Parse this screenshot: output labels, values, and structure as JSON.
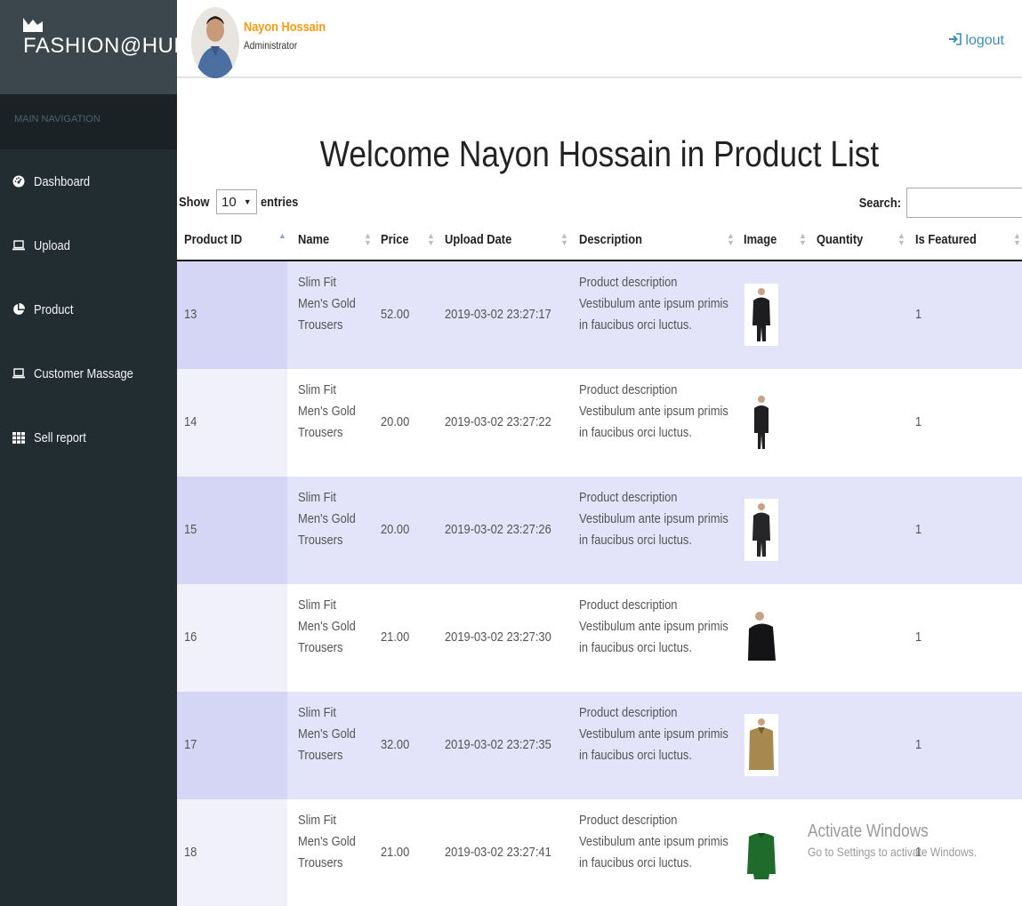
{
  "brand": {
    "name": "FASHION@HUB"
  },
  "sidebar": {
    "header": "MAIN NAVIGATION",
    "items": [
      {
        "label": "Dashboard",
        "icon": "dashboard-icon"
      },
      {
        "label": "Upload",
        "icon": "laptop-icon"
      },
      {
        "label": "Product",
        "icon": "pie-chart-icon"
      },
      {
        "label": "Customer Massage",
        "icon": "laptop-icon"
      },
      {
        "label": "Sell report",
        "icon": "grid-icon"
      }
    ]
  },
  "header": {
    "user_name": "Nayon Hossain",
    "user_role": "Administrator",
    "logout_label": "logout"
  },
  "main": {
    "title": "Welcome Nayon Hossain in Product List",
    "show_label": "Show",
    "entries_value": "10",
    "entries_label": "entries",
    "search_label": "Search:",
    "search_value": ""
  },
  "table": {
    "columns": [
      "Product ID",
      "Name",
      "Price",
      "Upload Date",
      "Description",
      "Image",
      "Quantity",
      "Is Featured"
    ],
    "rows": [
      {
        "id": "13",
        "name": [
          "Slim Fit",
          "Men's Gold",
          "Trousers"
        ],
        "price": "52.00",
        "date": "2019-03-02 23:27:17",
        "desc": [
          "Product description",
          "Vestibulum ante ipsum primis",
          "in faucibus orci luctus."
        ],
        "quantity": "",
        "featured": "1",
        "image_color": "#1d1d1f"
      },
      {
        "id": "14",
        "name": [
          "Slim Fit",
          "Men's Gold",
          "Trousers"
        ],
        "price": "20.00",
        "date": "2019-03-02 23:27:22",
        "desc": [
          "Product description",
          "Vestibulum ante ipsum primis",
          "in faucibus orci luctus."
        ],
        "quantity": "",
        "featured": "1",
        "image_color": "#202022"
      },
      {
        "id": "15",
        "name": [
          "Slim Fit",
          "Men's Gold",
          "Trousers"
        ],
        "price": "20.00",
        "date": "2019-03-02 23:27:26",
        "desc": [
          "Product description",
          "Vestibulum ante ipsum primis",
          "in faucibus orci luctus."
        ],
        "quantity": "",
        "featured": "1",
        "image_color": "#262628"
      },
      {
        "id": "16",
        "name": [
          "Slim Fit",
          "Men's Gold",
          "Trousers"
        ],
        "price": "21.00",
        "date": "2019-03-02 23:27:30",
        "desc": [
          "Product description",
          "Vestibulum ante ipsum primis",
          "in faucibus orci luctus."
        ],
        "quantity": "",
        "featured": "1",
        "image_color": "#141416"
      },
      {
        "id": "17",
        "name": [
          "Slim Fit",
          "Men's Gold",
          "Trousers"
        ],
        "price": "32.00",
        "date": "2019-03-02 23:27:35",
        "desc": [
          "Product description",
          "Vestibulum ante ipsum primis",
          "in faucibus orci luctus."
        ],
        "quantity": "",
        "featured": "1",
        "image_color": "#a7894f"
      },
      {
        "id": "18",
        "name": [
          "Slim Fit",
          "Men's Gold",
          "Trousers"
        ],
        "price": "21.00",
        "date": "2019-03-02 23:27:41",
        "desc": [
          "Product description",
          "Vestibulum ante ipsum primis",
          "in faucibus orci luctus."
        ],
        "quantity": "",
        "featured": "1",
        "image_color": "#1f6b2c"
      }
    ]
  },
  "watermark": {
    "line1": "Activate Windows",
    "line2": "Go to Settings to activate Windows."
  }
}
